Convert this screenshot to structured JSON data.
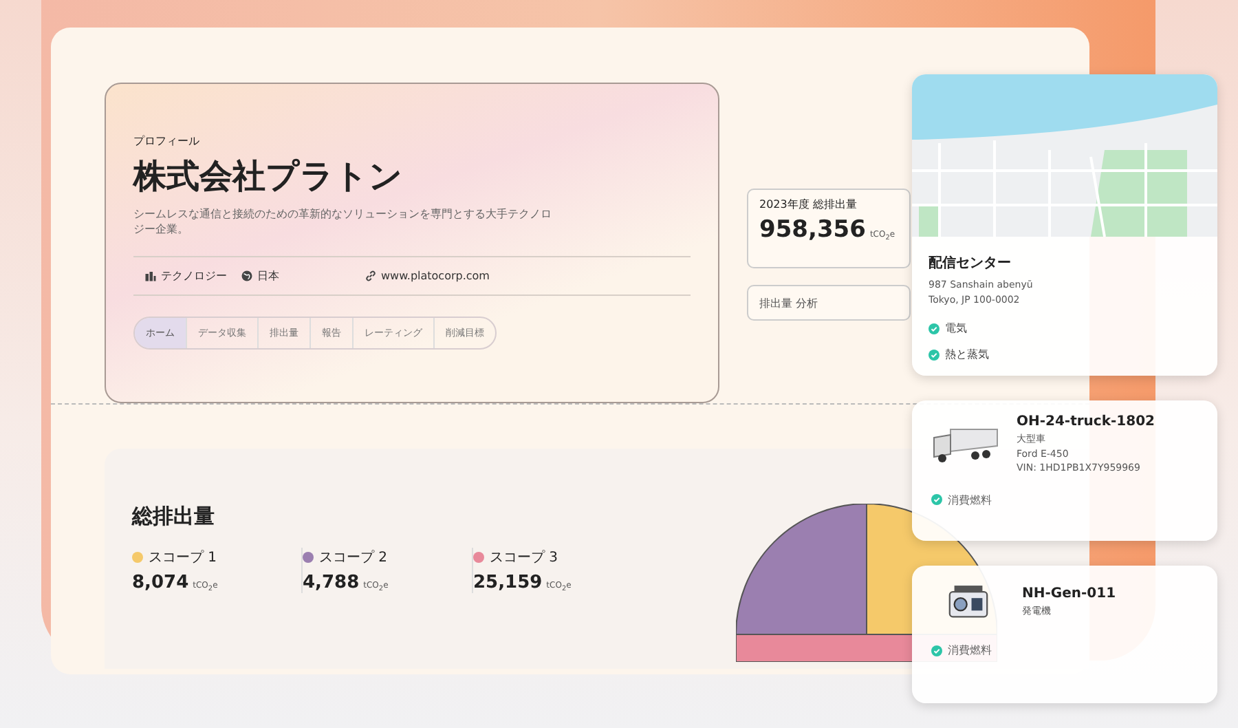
{
  "profile": {
    "eyebrow": "プロフィール",
    "company": "株式会社プラトン",
    "description": "シームレスな通信と接続のための革新的なソリューションを専門とする大手テクノロジー企業。",
    "meta": [
      {
        "kind": "industry",
        "text": "テクノロジー"
      },
      {
        "kind": "country",
        "text": "日本"
      },
      {
        "kind": "link",
        "text": "www.platocorp.com"
      }
    ],
    "tabs": [
      {
        "label": "ホーム",
        "selected": true
      },
      {
        "label": "データ収集",
        "selected": false
      },
      {
        "label": "排出量",
        "selected": false
      },
      {
        "label": "報告",
        "selected": false
      },
      {
        "label": "レーティング",
        "selected": false
      },
      {
        "label": "削減目標",
        "selected": false
      }
    ]
  },
  "kpi": {
    "label": "2023年度 総排出量",
    "value": "958,356",
    "unit": "tCO$_{2}$e"
  },
  "analysis_button": "排出量 分析",
  "total": {
    "title": "総排出量",
    "scopes": [
      {
        "name": "スコープ 1",
        "color": "#f5c96a",
        "value": "8,074",
        "unit": "tCO$_{2}$e"
      },
      {
        "name": "スコープ 2",
        "color": "#9b7fb0",
        "value": "4,788",
        "unit": "tCO$_{2}$e"
      },
      {
        "name": "スコープ 3",
        "color": "#e8899a",
        "value": "25,159",
        "unit": "tCO$_{2}$e"
      }
    ]
  },
  "facility": {
    "name": "配信センター",
    "address": [
      "987 Sanshain abenyū",
      "Tokyo, JP 100-0002"
    ],
    "sources": [
      "電気",
      "熱と蒸気"
    ]
  },
  "assets": [
    {
      "kind": "truck",
      "name": "OH-24-truck-1802",
      "details": [
        "大型車",
        "Ford E-450",
        "VIN: 1HD1PB1X7Y959969"
      ],
      "sources": [
        "消費燃料"
      ]
    },
    {
      "kind": "generator",
      "name": "NH-Gen-011",
      "details": [
        "発電機"
      ],
      "sources": [
        "消費燃料"
      ]
    }
  ]
}
